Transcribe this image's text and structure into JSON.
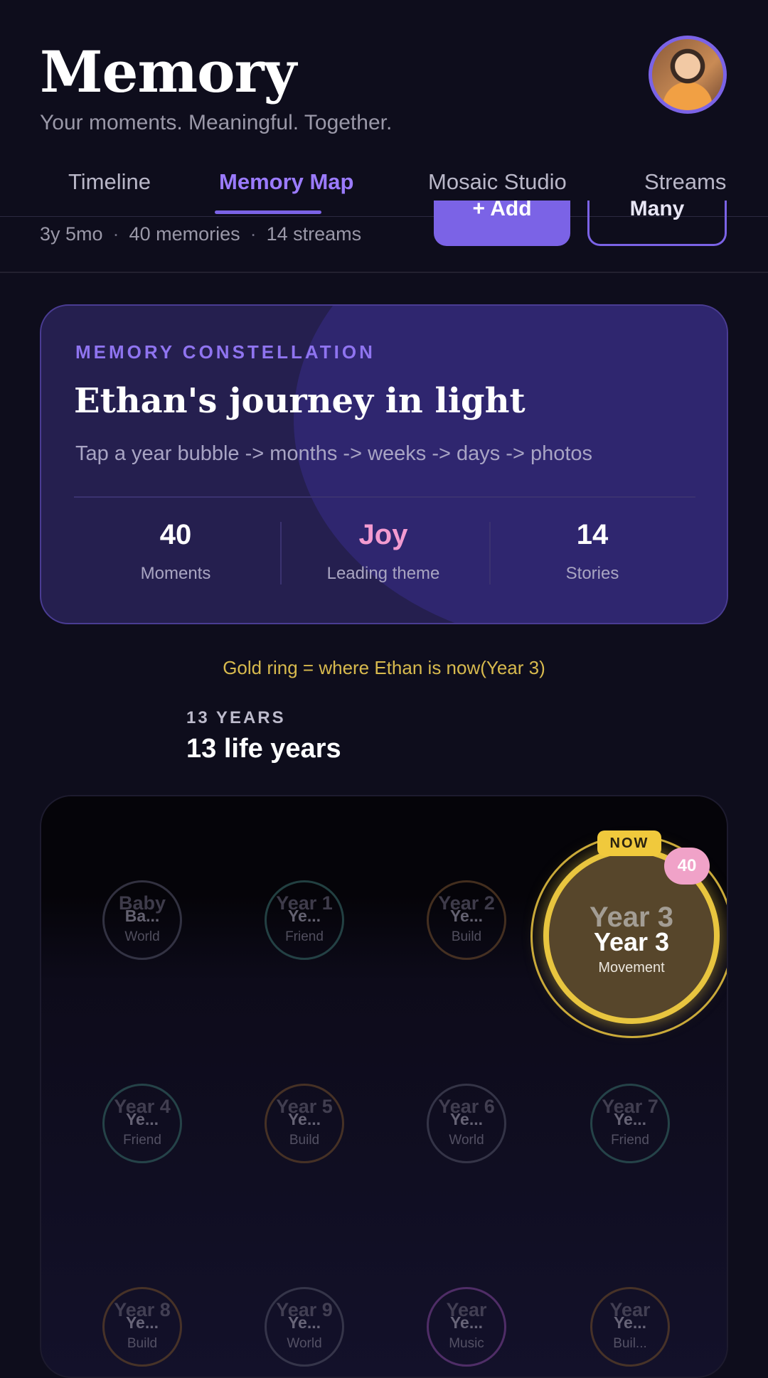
{
  "header": {
    "title": "Memory",
    "tagline": "Your moments. Meaningful. Together."
  },
  "tabs": [
    {
      "label": "Timeline"
    },
    {
      "label": "Memory Map"
    },
    {
      "label": "Mosaic Studio"
    },
    {
      "label": "Streams"
    }
  ],
  "summary": {
    "age": "3y 5mo",
    "memories": "40 memories",
    "streams": "14 streams",
    "add_label": "+ Add",
    "many_label": "Many"
  },
  "constellation": {
    "label": "MEMORY CONSTELLATION",
    "title": "Ethan's journey in light",
    "subtitle": "Tap a year bubble -> months -> weeks -> days -> photos",
    "stats": [
      {
        "value": "40",
        "label": "Moments"
      },
      {
        "value": "Joy",
        "label": "Leading theme"
      },
      {
        "value": "14",
        "label": "Stories"
      }
    ]
  },
  "hint": "Gold ring = where Ethan is now(Year 3)",
  "years_section": {
    "label": "13 YEARS",
    "title": "13 life years"
  },
  "bubbles": [
    {
      "ghost": "Baby",
      "name": "Ba...",
      "theme": "World"
    },
    {
      "ghost": "Year 1",
      "name": "Ye...",
      "theme": "Friend"
    },
    {
      "ghost": "Year 2",
      "name": "Ye...",
      "theme": "Build"
    },
    {
      "ghost": "Year 4",
      "name": "Ye...",
      "theme": "Friend"
    },
    {
      "ghost": "Year 5",
      "name": "Ye...",
      "theme": "Build"
    },
    {
      "ghost": "Year 6",
      "name": "Ye...",
      "theme": "World"
    },
    {
      "ghost": "Year 7",
      "name": "Ye...",
      "theme": "Friend"
    },
    {
      "ghost": "Year 8",
      "name": "Ye...",
      "theme": "Build"
    },
    {
      "ghost": "Year 9",
      "name": "Ye...",
      "theme": "World"
    },
    {
      "ghost": "Year",
      "name": "Ye...",
      "theme": "Music"
    },
    {
      "ghost": "Year",
      "name": "Ye...",
      "theme": "Buil..."
    }
  ],
  "current_year": {
    "tag": "NOW",
    "count": "40",
    "ghost": "Year 3",
    "name": "Year 3",
    "theme": "Movement"
  },
  "colors": {
    "accent": "#7b63e6",
    "gold": "#e8c53f",
    "pink": "#f39bd0",
    "background": "#0e0d1c"
  }
}
